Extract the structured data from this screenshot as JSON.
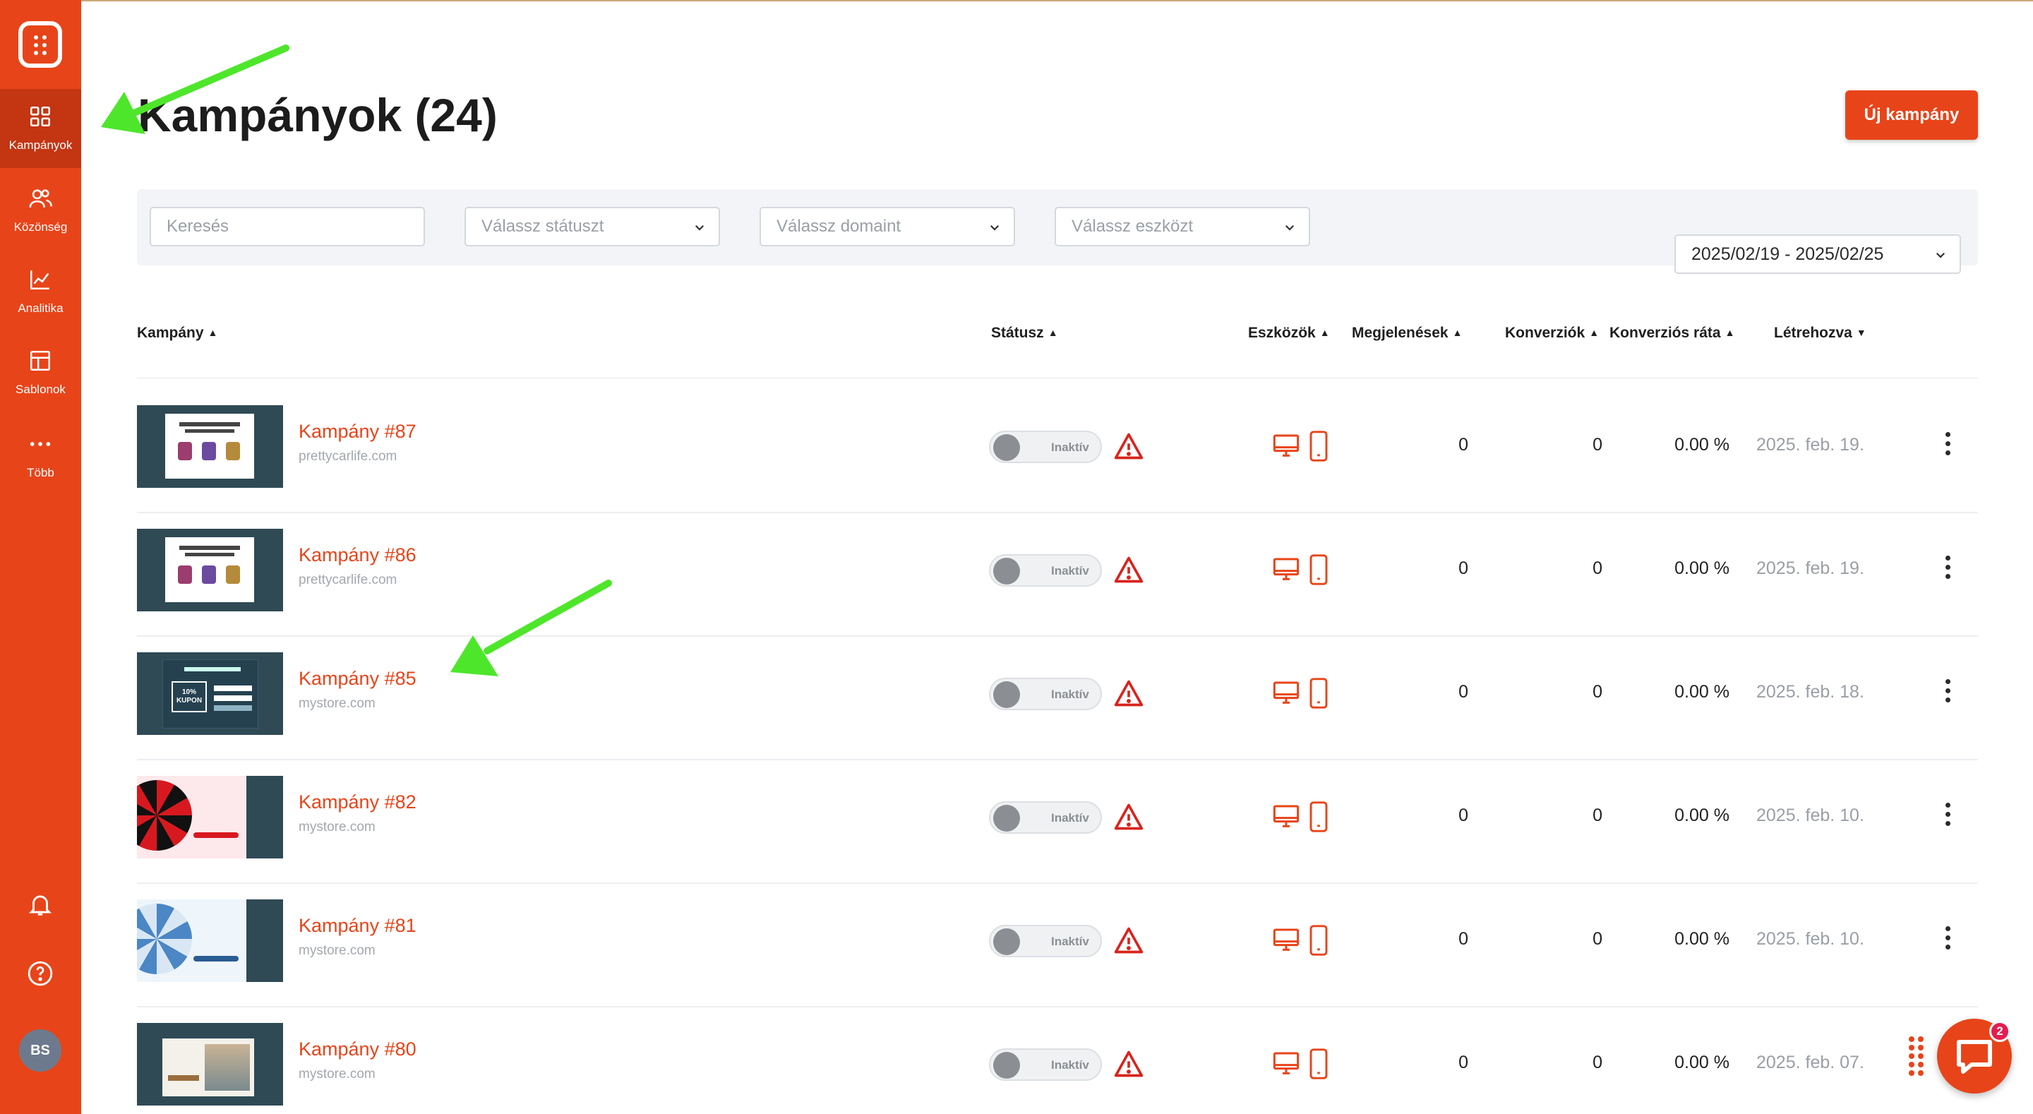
{
  "sidebar": {
    "items": [
      {
        "label": "Kampányok",
        "icon": "grid-icon",
        "active": true
      },
      {
        "label": "Közönség",
        "icon": "users-icon"
      },
      {
        "label": "Analitika",
        "icon": "chart-icon"
      },
      {
        "label": "Sablonok",
        "icon": "template-icon"
      },
      {
        "label": "Több",
        "icon": "more-icon"
      }
    ],
    "avatar": "BS"
  },
  "header": {
    "title": "Kampányok (24)",
    "new_button": "Új kampány"
  },
  "filters": {
    "search_placeholder": "Keresés",
    "status_placeholder": "Válassz státuszt",
    "domain_placeholder": "Válassz domaint",
    "device_placeholder": "Válassz eszközt",
    "date_range": "2025/02/19 - 2025/02/25"
  },
  "columns": {
    "campaign": "Kampány",
    "status": "Státusz",
    "devices": "Eszközök",
    "impressions": "Megjelenések",
    "conversions": "Konverziók",
    "conversion_rate": "Konverziós ráta",
    "created": "Létrehozva"
  },
  "rows": [
    {
      "name": "Kampány #87",
      "domain": "prettycarlife.com",
      "status": "Inaktív",
      "impressions": "0",
      "conversions": "0",
      "rate": "0.00 %",
      "created": "2025. feb. 19.",
      "thumb": "product"
    },
    {
      "name": "Kampány #86",
      "domain": "prettycarlife.com",
      "status": "Inaktív",
      "impressions": "0",
      "conversions": "0",
      "rate": "0.00 %",
      "created": "2025. feb. 19.",
      "thumb": "product"
    },
    {
      "name": "Kampány #85",
      "domain": "mystore.com",
      "status": "Inaktív",
      "impressions": "0",
      "conversions": "0",
      "rate": "0.00 %",
      "created": "2025. feb. 18.",
      "thumb": "coupon"
    },
    {
      "name": "Kampány #82",
      "domain": "mystore.com",
      "status": "Inaktív",
      "impressions": "0",
      "conversions": "0",
      "rate": "0.00 %",
      "created": "2025. feb. 10.",
      "thumb": "wheel"
    },
    {
      "name": "Kampány #81",
      "domain": "mystore.com",
      "status": "Inaktív",
      "impressions": "0",
      "conversions": "0",
      "rate": "0.00 %",
      "created": "2025. feb. 10.",
      "thumb": "wheel-blue"
    },
    {
      "name": "Kampány #80",
      "domain": "mystore.com",
      "status": "Inaktív",
      "impressions": "0",
      "conversions": "0",
      "rate": "0.00 %",
      "created": "2025. feb. 07.",
      "thumb": "photo"
    }
  ],
  "chat": {
    "badge": "2"
  },
  "colors": {
    "accent": "#e84419",
    "sidebar": "#e84419",
    "arrow": "#4ee62b"
  }
}
